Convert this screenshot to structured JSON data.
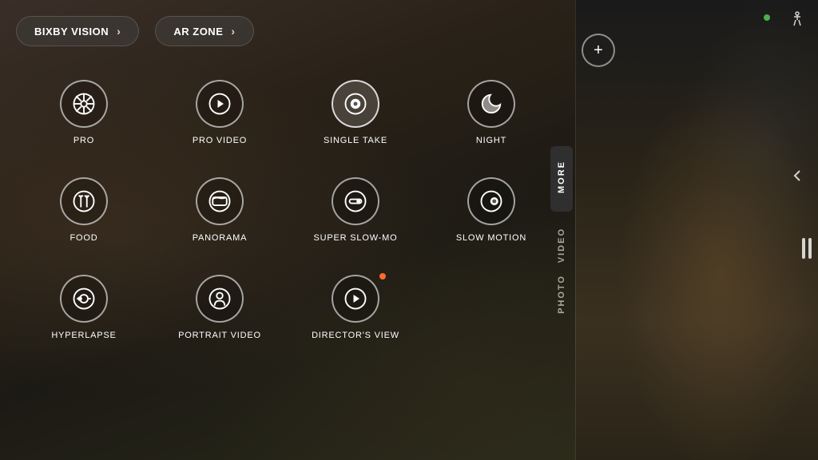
{
  "topBar": {
    "bixbyLabel": "BIXBY VISION",
    "arZoneLabel": "AR ZONE"
  },
  "modes": [
    {
      "id": "pro",
      "label": "PRO",
      "icon": "aperture",
      "special": false,
      "dot": false
    },
    {
      "id": "pro-video",
      "label": "PRO VIDEO",
      "icon": "play-circle",
      "special": false,
      "dot": false
    },
    {
      "id": "single-take",
      "label": "SINGLE TAKE",
      "icon": "circle-dot",
      "special": true,
      "dot": false
    },
    {
      "id": "night",
      "label": "NIGHT",
      "icon": "moon",
      "special": false,
      "dot": false
    },
    {
      "id": "food",
      "label": "FOOD",
      "icon": "utensils",
      "special": false,
      "dot": false
    },
    {
      "id": "panorama",
      "label": "PANORAMA",
      "icon": "panorama",
      "special": false,
      "dot": false
    },
    {
      "id": "super-slow-mo",
      "label": "SUPER SLOW-MO",
      "icon": "toggle",
      "special": false,
      "dot": false
    },
    {
      "id": "slow-motion",
      "label": "SLOW MOTION",
      "icon": "circle-inner",
      "special": false,
      "dot": false
    },
    {
      "id": "hyperlapse",
      "label": "HYPERLAPSE",
      "icon": "hyperlapse",
      "special": false,
      "dot": false
    },
    {
      "id": "portrait-video",
      "label": "PORTRAIT VIDEO",
      "icon": "portrait",
      "special": false,
      "dot": false
    },
    {
      "id": "directors-view",
      "label": "DIRECTOR'S VIEW",
      "icon": "play-circle",
      "special": false,
      "dot": true
    }
  ],
  "sidebar": {
    "moreLabel": "MORE",
    "videoLabel": "VIDEO",
    "photoLabel": "PHOTO"
  },
  "rightPanel": {
    "plusLabel": "+",
    "greenDot": true
  }
}
